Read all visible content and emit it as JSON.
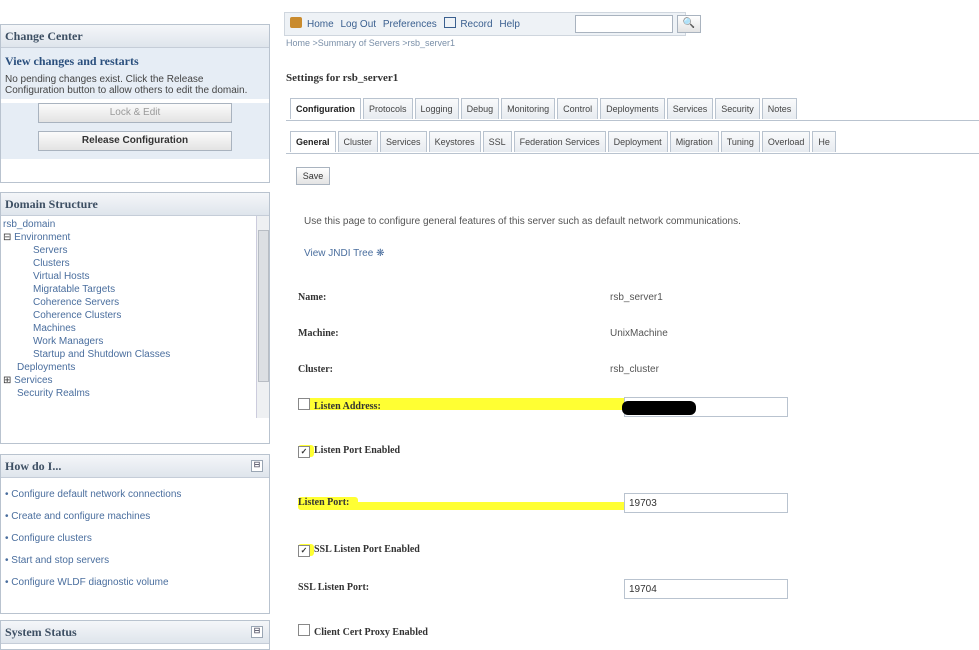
{
  "change_center": {
    "title": "Change Center",
    "subtitle": "View changes and restarts",
    "text": "No pending changes exist. Click the Release Configuration button to allow others to edit the domain.",
    "lock_edit": "Lock & Edit",
    "release_config": "Release Configuration"
  },
  "domain_structure": {
    "title": "Domain Structure",
    "root": "rsb_domain",
    "environment": "Environment",
    "items": [
      "Servers",
      "Clusters",
      "Virtual Hosts",
      "Migratable Targets",
      "Coherence Servers",
      "Coherence Clusters",
      "Machines",
      "Work Managers",
      "Startup and Shutdown Classes"
    ],
    "deployments": "Deployments",
    "services": "Services",
    "security_realms": "Security Realms"
  },
  "how_do_i": {
    "title": "How do I...",
    "items": [
      "Configure default network connections",
      "Create and configure machines",
      "Configure clusters",
      "Start and stop servers",
      "Configure WLDF diagnostic volume"
    ]
  },
  "system_status": {
    "title": "System Status"
  },
  "topbar": {
    "home": "Home",
    "logout": "Log Out",
    "preferences": "Preferences",
    "record": "Record",
    "help": "Help",
    "search_placeholder": ""
  },
  "breadcrumb": "Home >Summary of Servers >rsb_server1",
  "settings_title": "Settings for rsb_server1",
  "tabs_primary": [
    "Configuration",
    "Protocols",
    "Logging",
    "Debug",
    "Monitoring",
    "Control",
    "Deployments",
    "Services",
    "Security",
    "Notes"
  ],
  "tabs_secondary": [
    "General",
    "Cluster",
    "Services",
    "Keystores",
    "SSL",
    "Federation Services",
    "Deployment",
    "Migration",
    "Tuning",
    "Overload",
    "He"
  ],
  "save_label": "Save",
  "intro_text": "Use this page to configure general features of this server such as default network communications.",
  "jndi_link": "View JNDI Tree",
  "fields": {
    "name_label": "Name:",
    "name_value": "rsb_server1",
    "machine_label": "Machine:",
    "machine_value": "UnixMachine",
    "cluster_label": "Cluster:",
    "cluster_value": "rsb_cluster",
    "listen_address_label": "Listen Address:",
    "listen_port_enabled_label": "Listen Port Enabled",
    "listen_port_label": "Listen Port:",
    "listen_port_value": "19703",
    "ssl_listen_port_enabled_label": "SSL Listen Port Enabled",
    "ssl_listen_port_label": "SSL Listen Port:",
    "ssl_listen_port_value": "19704",
    "client_cert_label": "Client Cert Proxy Enabled"
  },
  "colors": {
    "highlight": "#ffff33",
    "link": "#4a6e9e",
    "header": "#3d4f63"
  }
}
